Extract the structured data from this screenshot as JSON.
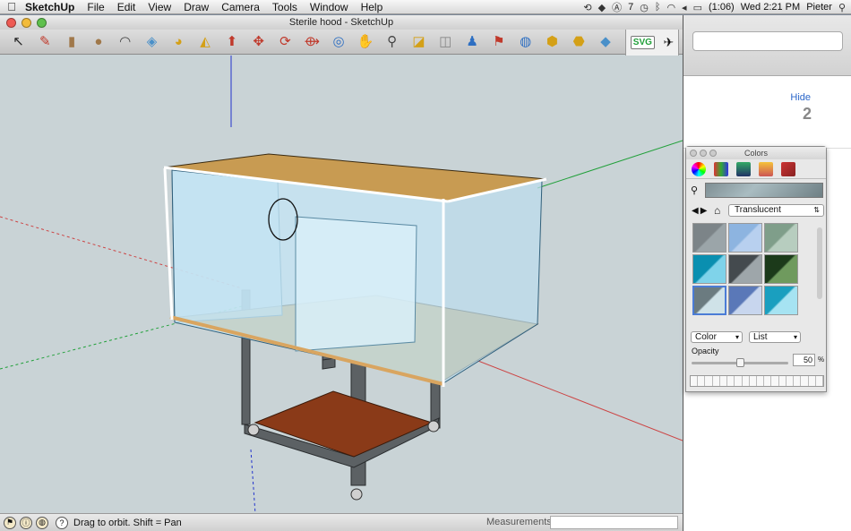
{
  "menubar": {
    "apple_icon": "",
    "app_name": "SketchUp",
    "items": [
      "File",
      "Edit",
      "View",
      "Draw",
      "Camera",
      "Tools",
      "Window",
      "Help"
    ],
    "status": {
      "adobe_count": "7",
      "battery": "(1:06)",
      "clock": "Wed 2:21 PM",
      "user": "Pieter"
    }
  },
  "window": {
    "title": "Sterile hood - SketchUp",
    "plugin_svg_label": "SVG"
  },
  "toolbar": {
    "tools": [
      {
        "name": "select-tool",
        "icon": "↖",
        "color": "#222222"
      },
      {
        "name": "pencil-tool",
        "icon": "✎",
        "color": "#c0392b"
      },
      {
        "name": "rectangle-tool",
        "icon": "▮",
        "color": "#a0784a"
      },
      {
        "name": "circle-tool",
        "icon": "●",
        "color": "#a0784a"
      },
      {
        "name": "arc-tool",
        "icon": "◠",
        "color": "#444444"
      },
      {
        "name": "make-component-tool",
        "icon": "◈",
        "color": "#4a90c9"
      },
      {
        "name": "paint-bucket-tool",
        "icon": "◕",
        "color": "#d4a017"
      },
      {
        "name": "eraser-tool",
        "icon": "◭",
        "color": "#d4a017"
      },
      {
        "name": "push-pull-tool",
        "icon": "⬆",
        "color": "#c0392b"
      },
      {
        "name": "move-tool",
        "icon": "✥",
        "color": "#c0392b"
      },
      {
        "name": "rotate-tool",
        "icon": "⟳",
        "color": "#c0392b"
      },
      {
        "name": "offset-tool",
        "icon": "⟴",
        "color": "#c0392b"
      },
      {
        "name": "orbit-tool",
        "icon": "◎",
        "color": "#2e6fc2"
      },
      {
        "name": "pan-tool",
        "icon": "✋",
        "color": "#555555"
      },
      {
        "name": "zoom-tool",
        "icon": "⚲",
        "color": "#444444"
      },
      {
        "name": "zoom-extents-tool",
        "icon": "◪",
        "color": "#d4a017"
      },
      {
        "name": "previous-view-tool",
        "icon": "◫",
        "color": "#888888"
      },
      {
        "name": "position-camera-tool",
        "icon": "♟",
        "color": "#2e6fc2"
      },
      {
        "name": "walk-tool",
        "icon": "⚑",
        "color": "#c0392b"
      },
      {
        "name": "3d-warehouse-tool",
        "icon": "◍",
        "color": "#2e6fc2"
      },
      {
        "name": "get-models-tool",
        "icon": "⬢",
        "color": "#d4a017"
      },
      {
        "name": "share-model-tool",
        "icon": "⬣",
        "color": "#d4a017"
      },
      {
        "name": "extension-warehouse-tool",
        "icon": "◆",
        "color": "#4a90c9"
      }
    ]
  },
  "statusbar": {
    "hint": "Drag to orbit.  Shift = Pan",
    "measurements_label": "Measurements",
    "measurements_value": ""
  },
  "background_window": {
    "hide_link": "Hide",
    "number": "2"
  },
  "colors_panel": {
    "title": "Colors",
    "library": "Translucent",
    "mode_dropdown": "Color",
    "view_dropdown": "List",
    "opacity_label": "Opacity",
    "opacity_value": "50",
    "opacity_fraction": 0.5,
    "opacity_unit": "%",
    "swatches": [
      {
        "name": "glass-block-swatch",
        "colors": [
          "#7c8488",
          "#9ba5a9"
        ]
      },
      {
        "name": "light-blue-swatch",
        "colors": [
          "#8db4e0",
          "#b8d0ef"
        ]
      },
      {
        "name": "green-stripe-swatch",
        "colors": [
          "#7f9e8a",
          "#b7cdbf"
        ]
      },
      {
        "name": "cyan-dark-swatch",
        "colors": [
          "#0a8fb0",
          "#7fd3ea"
        ]
      },
      {
        "name": "gray-dark-swatch",
        "colors": [
          "#444a4e",
          "#9ea6aa"
        ]
      },
      {
        "name": "dark-green-swatch",
        "colors": [
          "#1c3a1a",
          "#6f9a5e"
        ]
      },
      {
        "name": "translucent-glass-swatch",
        "colors": [
          "#6b7b80",
          "#cfe2e8"
        ],
        "selected": true
      },
      {
        "name": "sky-swatch",
        "colors": [
          "#5a78b8",
          "#c8d6ee"
        ]
      },
      {
        "name": "cyan-light-swatch",
        "colors": [
          "#1a9fbf",
          "#a6e3f2"
        ]
      }
    ]
  }
}
